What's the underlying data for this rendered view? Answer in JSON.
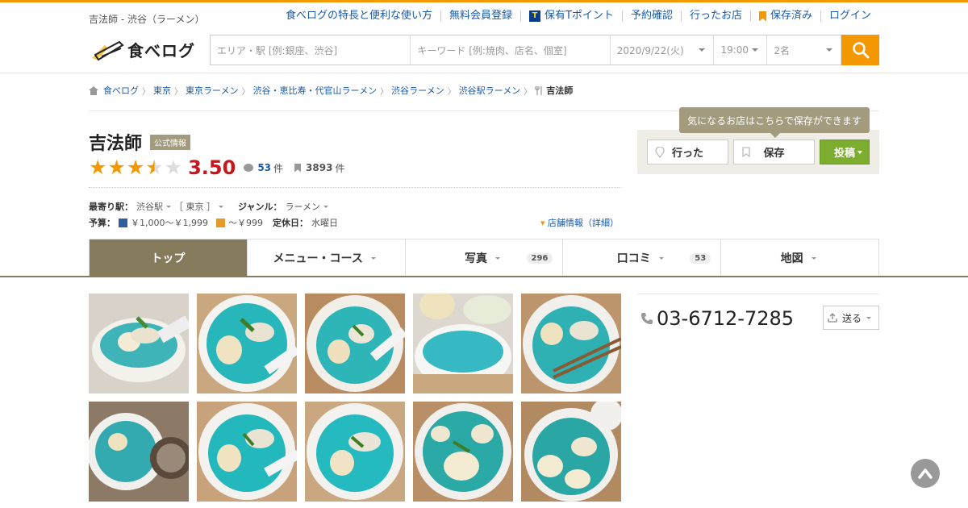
{
  "header": {
    "caption": "吉法師 - 渋谷（ラーメン）",
    "nav": [
      {
        "label": "食べログの特長と便利な使い方"
      },
      {
        "label": "無料会員登録"
      },
      {
        "label": "保有Tポイント",
        "icon": "t-point-icon"
      },
      {
        "label": "予約確認"
      },
      {
        "label": "行ったお店"
      },
      {
        "label": "保存済み",
        "icon": "bookmark-icon"
      },
      {
        "label": "ログイン"
      }
    ],
    "logo_text": "食べログ",
    "t_badge": "T",
    "search": {
      "area_placeholder": "エリア・駅 [例:銀座、渋谷]",
      "keyword_placeholder": "キーワード [例:焼肉、店名、個室]",
      "date": "2020/9/22(火)",
      "time": "19:00",
      "people": "2名"
    }
  },
  "breadcrumb": [
    "食べログ",
    "東京",
    "東京ラーメン",
    "渋谷・恵比寿・代官山ラーメン",
    "渋谷ラーメン",
    "渋谷駅ラーメン"
  ],
  "breadcrumb_current": "吉法師",
  "shop": {
    "name": "吉法師",
    "official_badge": "公式情報",
    "stars": 3.5,
    "score": "3.50",
    "reviews": "53",
    "reviews_unit": "件",
    "saves": "3893",
    "saves_unit": "件",
    "station_label": "最寄り駅：",
    "station": "渋谷駅",
    "line": "［ 東京 ］",
    "genre_label": "ジャンル：",
    "genre": "ラーメン",
    "budget_label": "予算：",
    "budget_dinner": "￥1,000～￥1,999",
    "budget_lunch": "～￥999",
    "holiday_label": "定休日：",
    "holiday": "水曜日",
    "detail_link": "店舗情報（詳細）"
  },
  "actions": {
    "tooltip": "気になるお店はこちらで保存ができます",
    "went": "行った",
    "save": "保存",
    "post": "投稿"
  },
  "tabs": [
    {
      "label": "トップ",
      "count": ""
    },
    {
      "label": "メニュー・コース",
      "count": ""
    },
    {
      "label": "写真",
      "count": "296"
    },
    {
      "label": "口コミ",
      "count": "53"
    },
    {
      "label": "地図",
      "count": ""
    }
  ],
  "contact": {
    "phone": "03-6712-7285",
    "send": "送る"
  },
  "colors": {
    "accent": "#f39800",
    "link": "#1a5aa8",
    "tab_active": "#857a5b",
    "score": "#c8161d",
    "post_button": "#7cad2e"
  }
}
